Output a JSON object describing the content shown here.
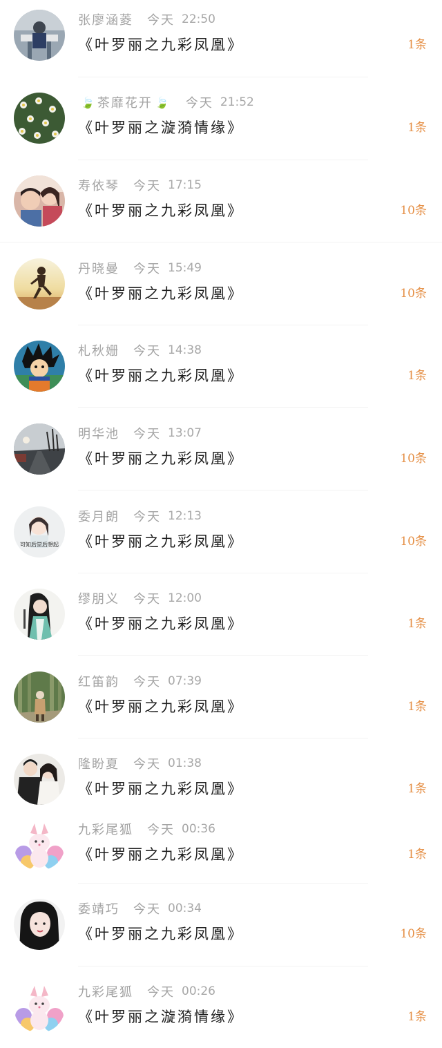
{
  "colors": {
    "meta_text": "#a3a3a3",
    "title_text": "#1e1e1e",
    "count_text": "#e58f45",
    "leaf": "#7fb341"
  },
  "rows": [
    {
      "name": "张廖涵菱",
      "leaf": false,
      "day": "今天",
      "time": "22:50",
      "title": "《叶罗丽之九彩凤凰》",
      "count": "1条",
      "avatar": "avatar-photo-desk"
    },
    {
      "name": "茶靡花开",
      "leaf": true,
      "leaf_icon": "🍃",
      "day": "今天",
      "time": "21:52",
      "title": "《叶罗丽之漩漪情缘》",
      "count": "1条",
      "avatar": "avatar-daisies"
    },
    {
      "name": "寿依琴",
      "leaf": false,
      "day": "今天",
      "time": "17:15",
      "title": "《叶罗丽之九彩凤凰》",
      "count": "10条",
      "avatar": "avatar-mother-child"
    },
    {
      "name": "丹晓曼",
      "leaf": false,
      "day": "今天",
      "time": "15:49",
      "title": "《叶罗丽之九彩凤凰》",
      "count": "10条",
      "avatar": "avatar-runner-sunset"
    },
    {
      "name": "札秋姗",
      "leaf": false,
      "day": "今天",
      "time": "14:38",
      "title": "《叶罗丽之九彩凤凰》",
      "count": "1条",
      "avatar": "avatar-cartoon-boy"
    },
    {
      "name": "明华池",
      "leaf": false,
      "day": "今天",
      "time": "13:07",
      "title": "《叶罗丽之九彩凤凰》",
      "count": "10条",
      "avatar": "avatar-road-sky"
    },
    {
      "name": "委月朗",
      "leaf": false,
      "day": "今天",
      "time": "12:13",
      "title": "《叶罗丽之九彩凤凰》",
      "count": "10条",
      "avatar": "avatar-girl-caption",
      "avatar_caption": "可知后觉后想起"
    },
    {
      "name": "缪朋义",
      "leaf": false,
      "day": "今天",
      "time": "12:00",
      "title": "《叶罗丽之九彩凤凰》",
      "count": "1条",
      "avatar": "avatar-ancient-style"
    },
    {
      "name": "红笛韵",
      "leaf": false,
      "day": "今天",
      "time": "07:39",
      "title": "《叶罗丽之九彩凤凰》",
      "count": "1条",
      "avatar": "avatar-forest-walker"
    },
    {
      "name": "隆盼夏",
      "leaf": false,
      "day": "今天",
      "time": "01:38",
      "title": "《叶罗丽之九彩凤凰》",
      "count": "1条",
      "avatar": "avatar-couple"
    },
    {
      "name": "九彩尾狐",
      "leaf": false,
      "day": "今天",
      "time": "00:36",
      "title": "《叶罗丽之九彩凤凰》",
      "count": "1条",
      "avatar": "avatar-fox"
    },
    {
      "name": "委靖巧",
      "leaf": false,
      "day": "今天",
      "time": "00:34",
      "title": "《叶罗丽之九彩凤凰》",
      "count": "10条",
      "avatar": "avatar-dark-hair-girl"
    },
    {
      "name": "九彩尾狐",
      "leaf": false,
      "day": "今天",
      "time": "00:26",
      "title": "《叶罗丽之漩漪情缘》",
      "count": "1条",
      "avatar": "avatar-fox"
    }
  ]
}
